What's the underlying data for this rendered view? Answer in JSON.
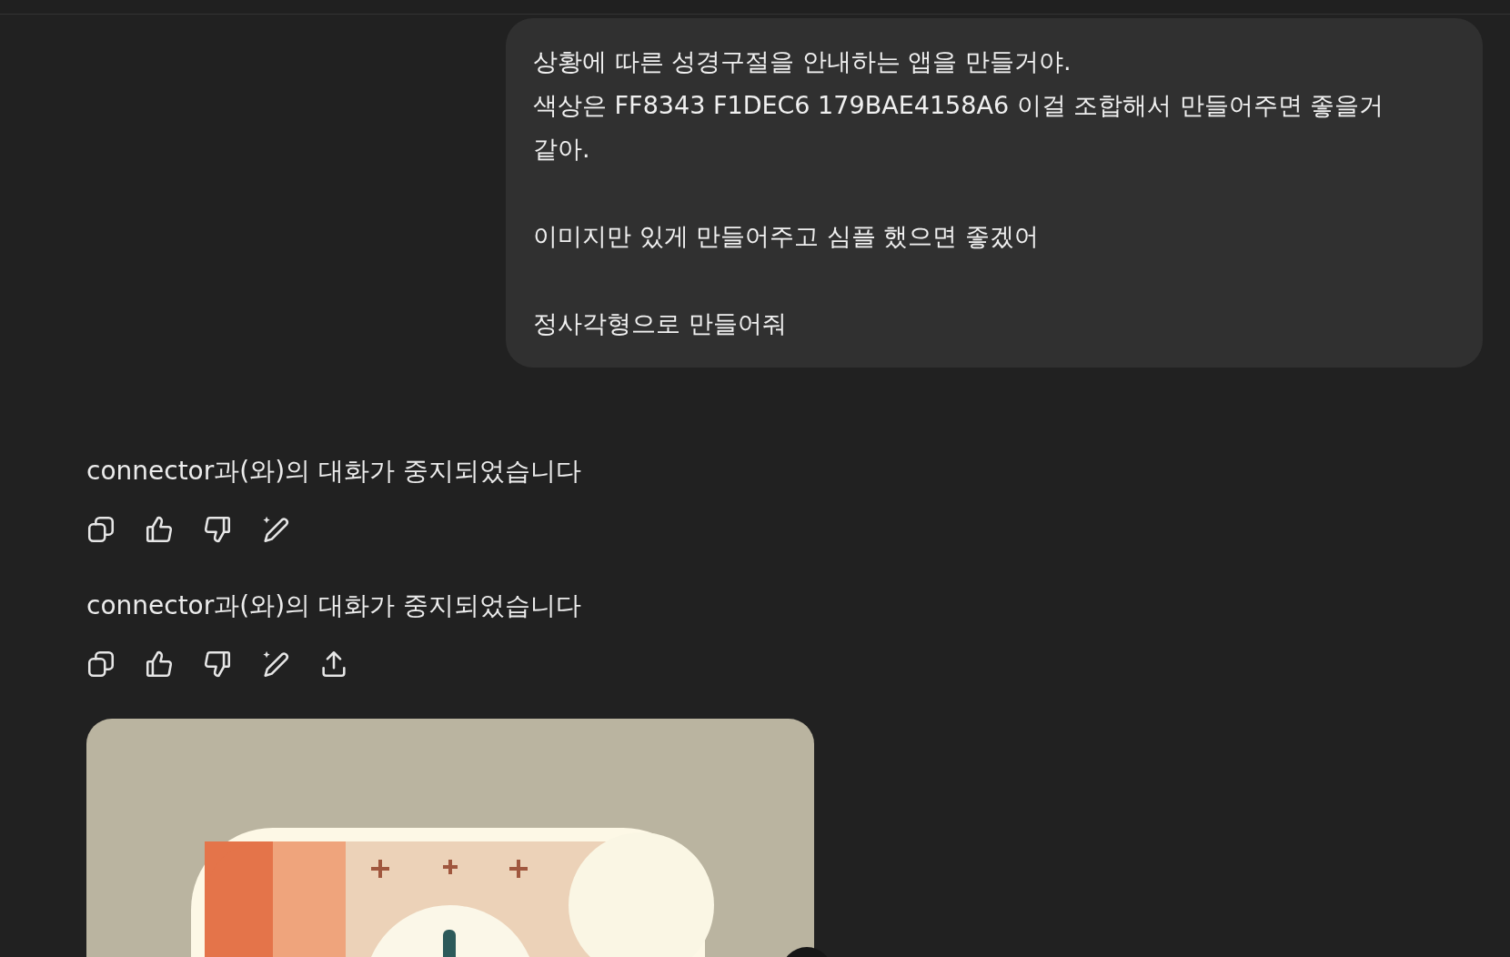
{
  "user_message": {
    "paragraphs": [
      [
        "상황에 따른 성경구절을 안내하는 앱을 만들거야.",
        "색상은 FF8343 F1DEC6 179BAE4158A6 이걸 조합해서 만들어주면 좋을거 같아."
      ],
      [
        "이미지만 있게 만들어주고 심플 했으면 좋겠어"
      ],
      [
        "정사각형으로 만들어줘"
      ]
    ]
  },
  "assistant_messages": [
    {
      "text": "connector과(와)의 대화가 중지되었습니다",
      "actions": [
        {
          "kind": "copy"
        },
        {
          "kind": "like"
        },
        {
          "kind": "dislike"
        },
        {
          "kind": "edit"
        }
      ]
    },
    {
      "text": "connector과(와)의 대화가 중지되었습니다",
      "actions": [
        {
          "kind": "copy"
        },
        {
          "kind": "like"
        },
        {
          "kind": "dislike"
        },
        {
          "kind": "edit"
        },
        {
          "kind": "share"
        }
      ]
    }
  ]
}
